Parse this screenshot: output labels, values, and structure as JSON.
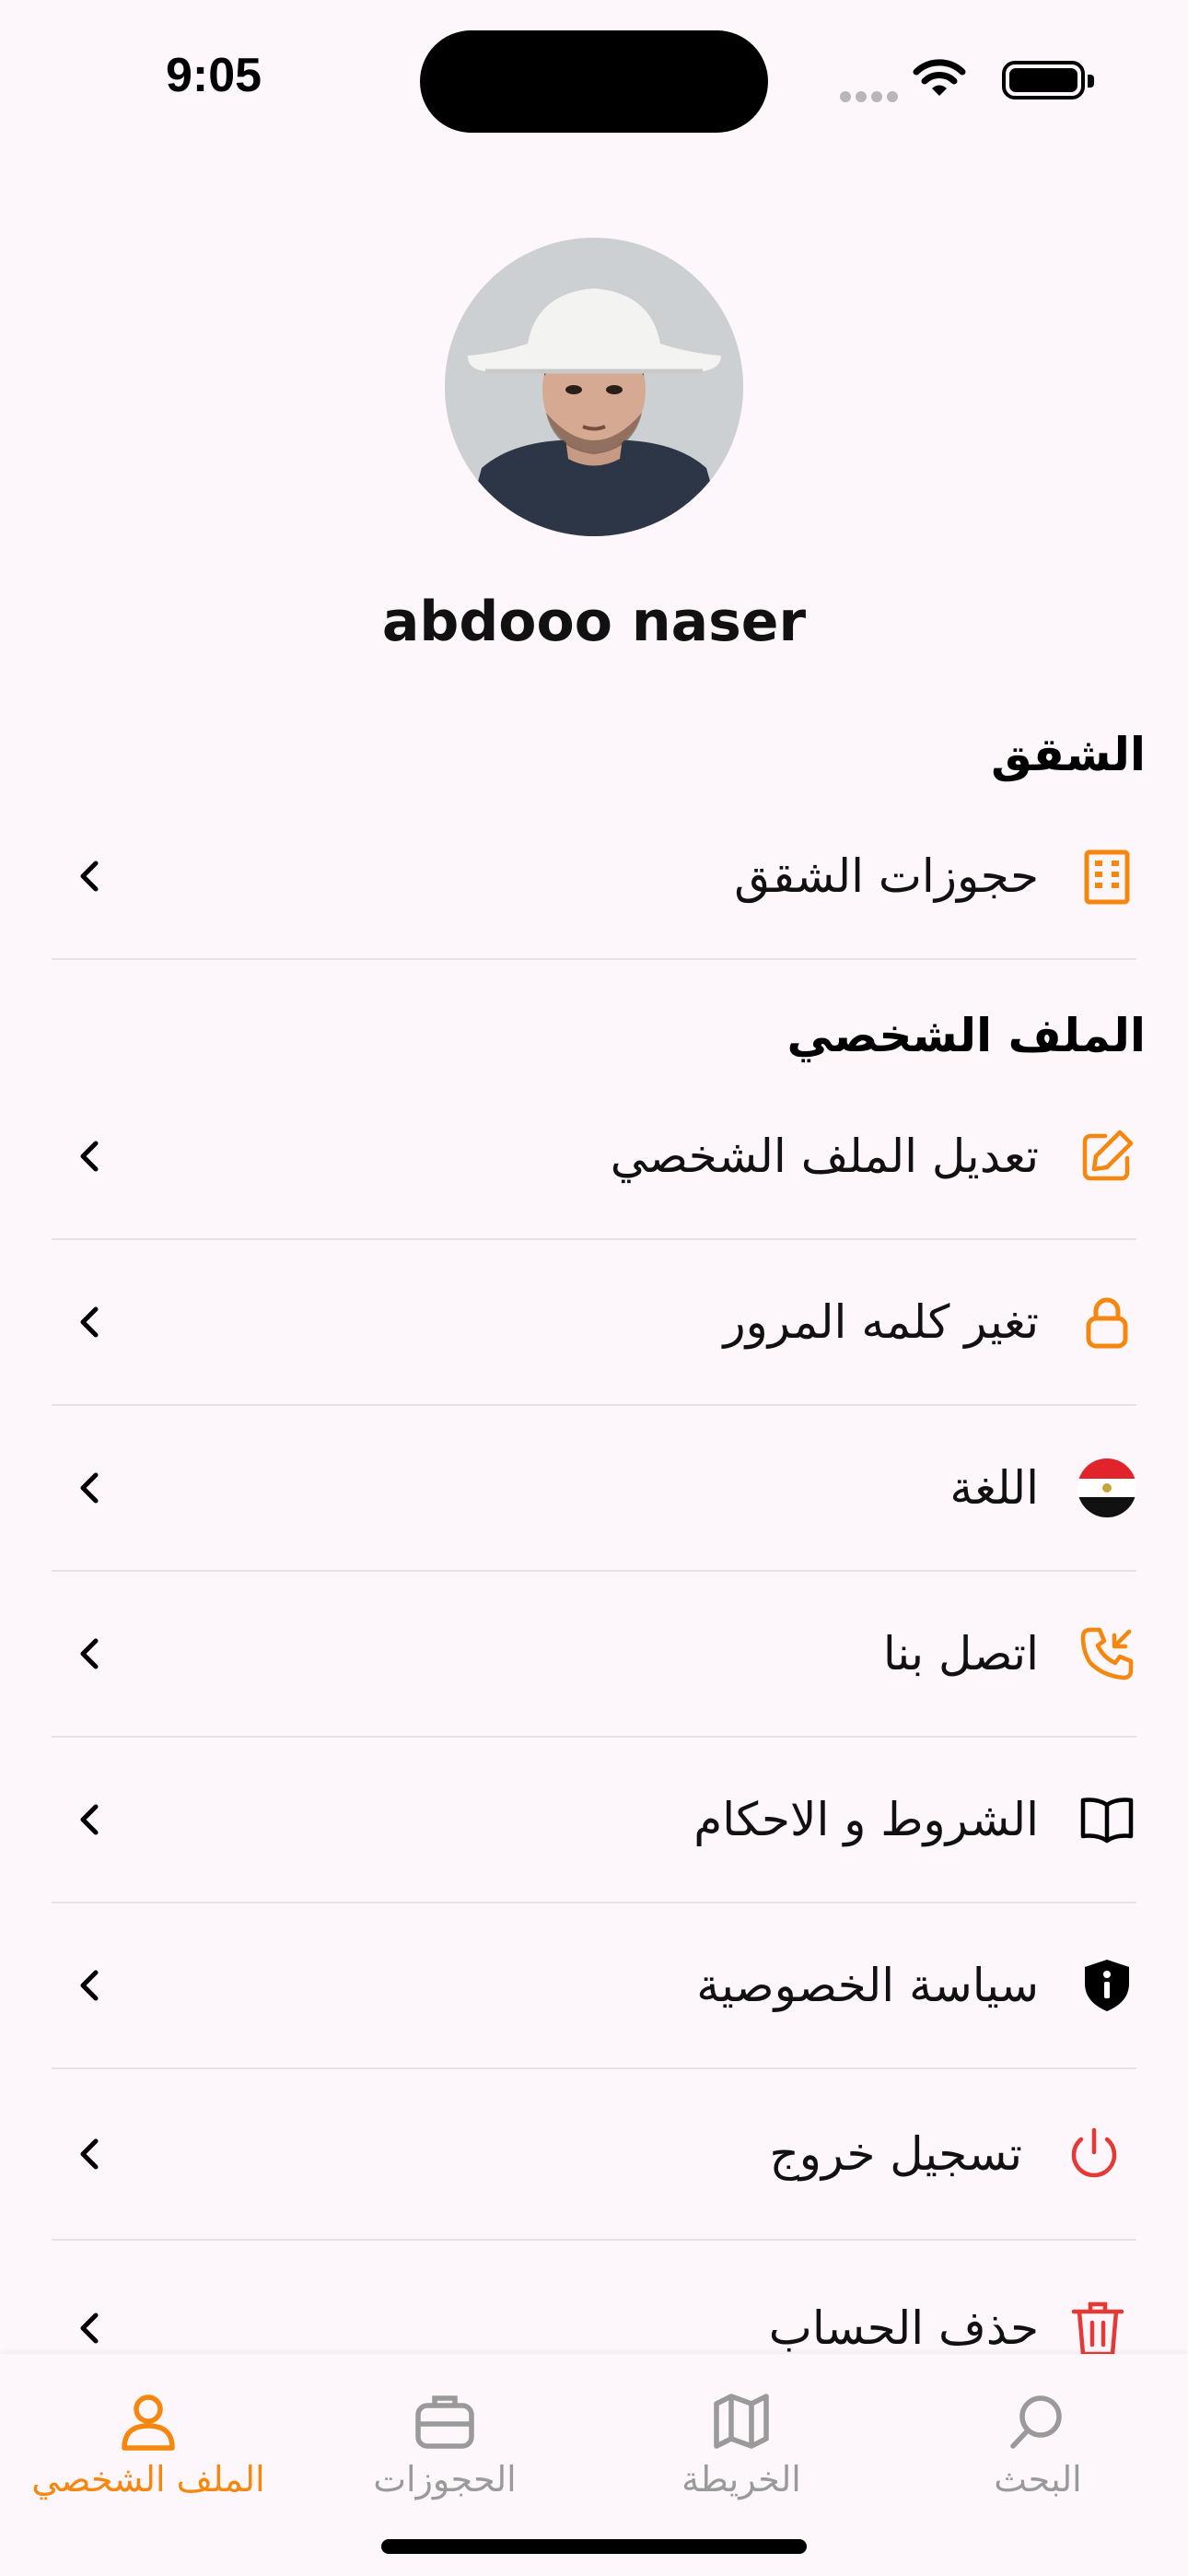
{
  "status_bar": {
    "time": "9:05"
  },
  "profile": {
    "name": "abdooo naser"
  },
  "sections": [
    {
      "title": "الشقق",
      "items": [
        {
          "label": "حجوزات الشقق",
          "icon": "building-icon"
        }
      ]
    },
    {
      "title": "الملف الشخصي",
      "items": [
        {
          "label": "تعديل الملف الشخصي",
          "icon": "edit-icon"
        },
        {
          "label": "تغير كلمه المرور",
          "icon": "lock-icon"
        },
        {
          "label": "اللغة",
          "icon": "egypt-flag-icon"
        },
        {
          "label": "اتصل بنا",
          "icon": "phone-incoming-icon"
        },
        {
          "label": "الشروط و الاحكام",
          "icon": "book-icon"
        },
        {
          "label": "سياسة الخصوصية",
          "icon": "shield-info-icon"
        },
        {
          "label": "تسجيل خروج",
          "icon": "power-icon"
        },
        {
          "label": "حذف الحساب",
          "icon": "trash-icon"
        }
      ]
    }
  ],
  "bottom_nav": [
    {
      "label": "الملف الشخصي",
      "icon": "user-icon",
      "active": true
    },
    {
      "label": "الحجوزات",
      "icon": "briefcase-icon",
      "active": false
    },
    {
      "label": "الخريطة",
      "icon": "map-icon",
      "active": false
    },
    {
      "label": "البحث",
      "icon": "search-icon",
      "active": false
    }
  ],
  "colors": {
    "accent": "#f5870f",
    "danger": "#e53935",
    "background": "#fdf6fb"
  }
}
